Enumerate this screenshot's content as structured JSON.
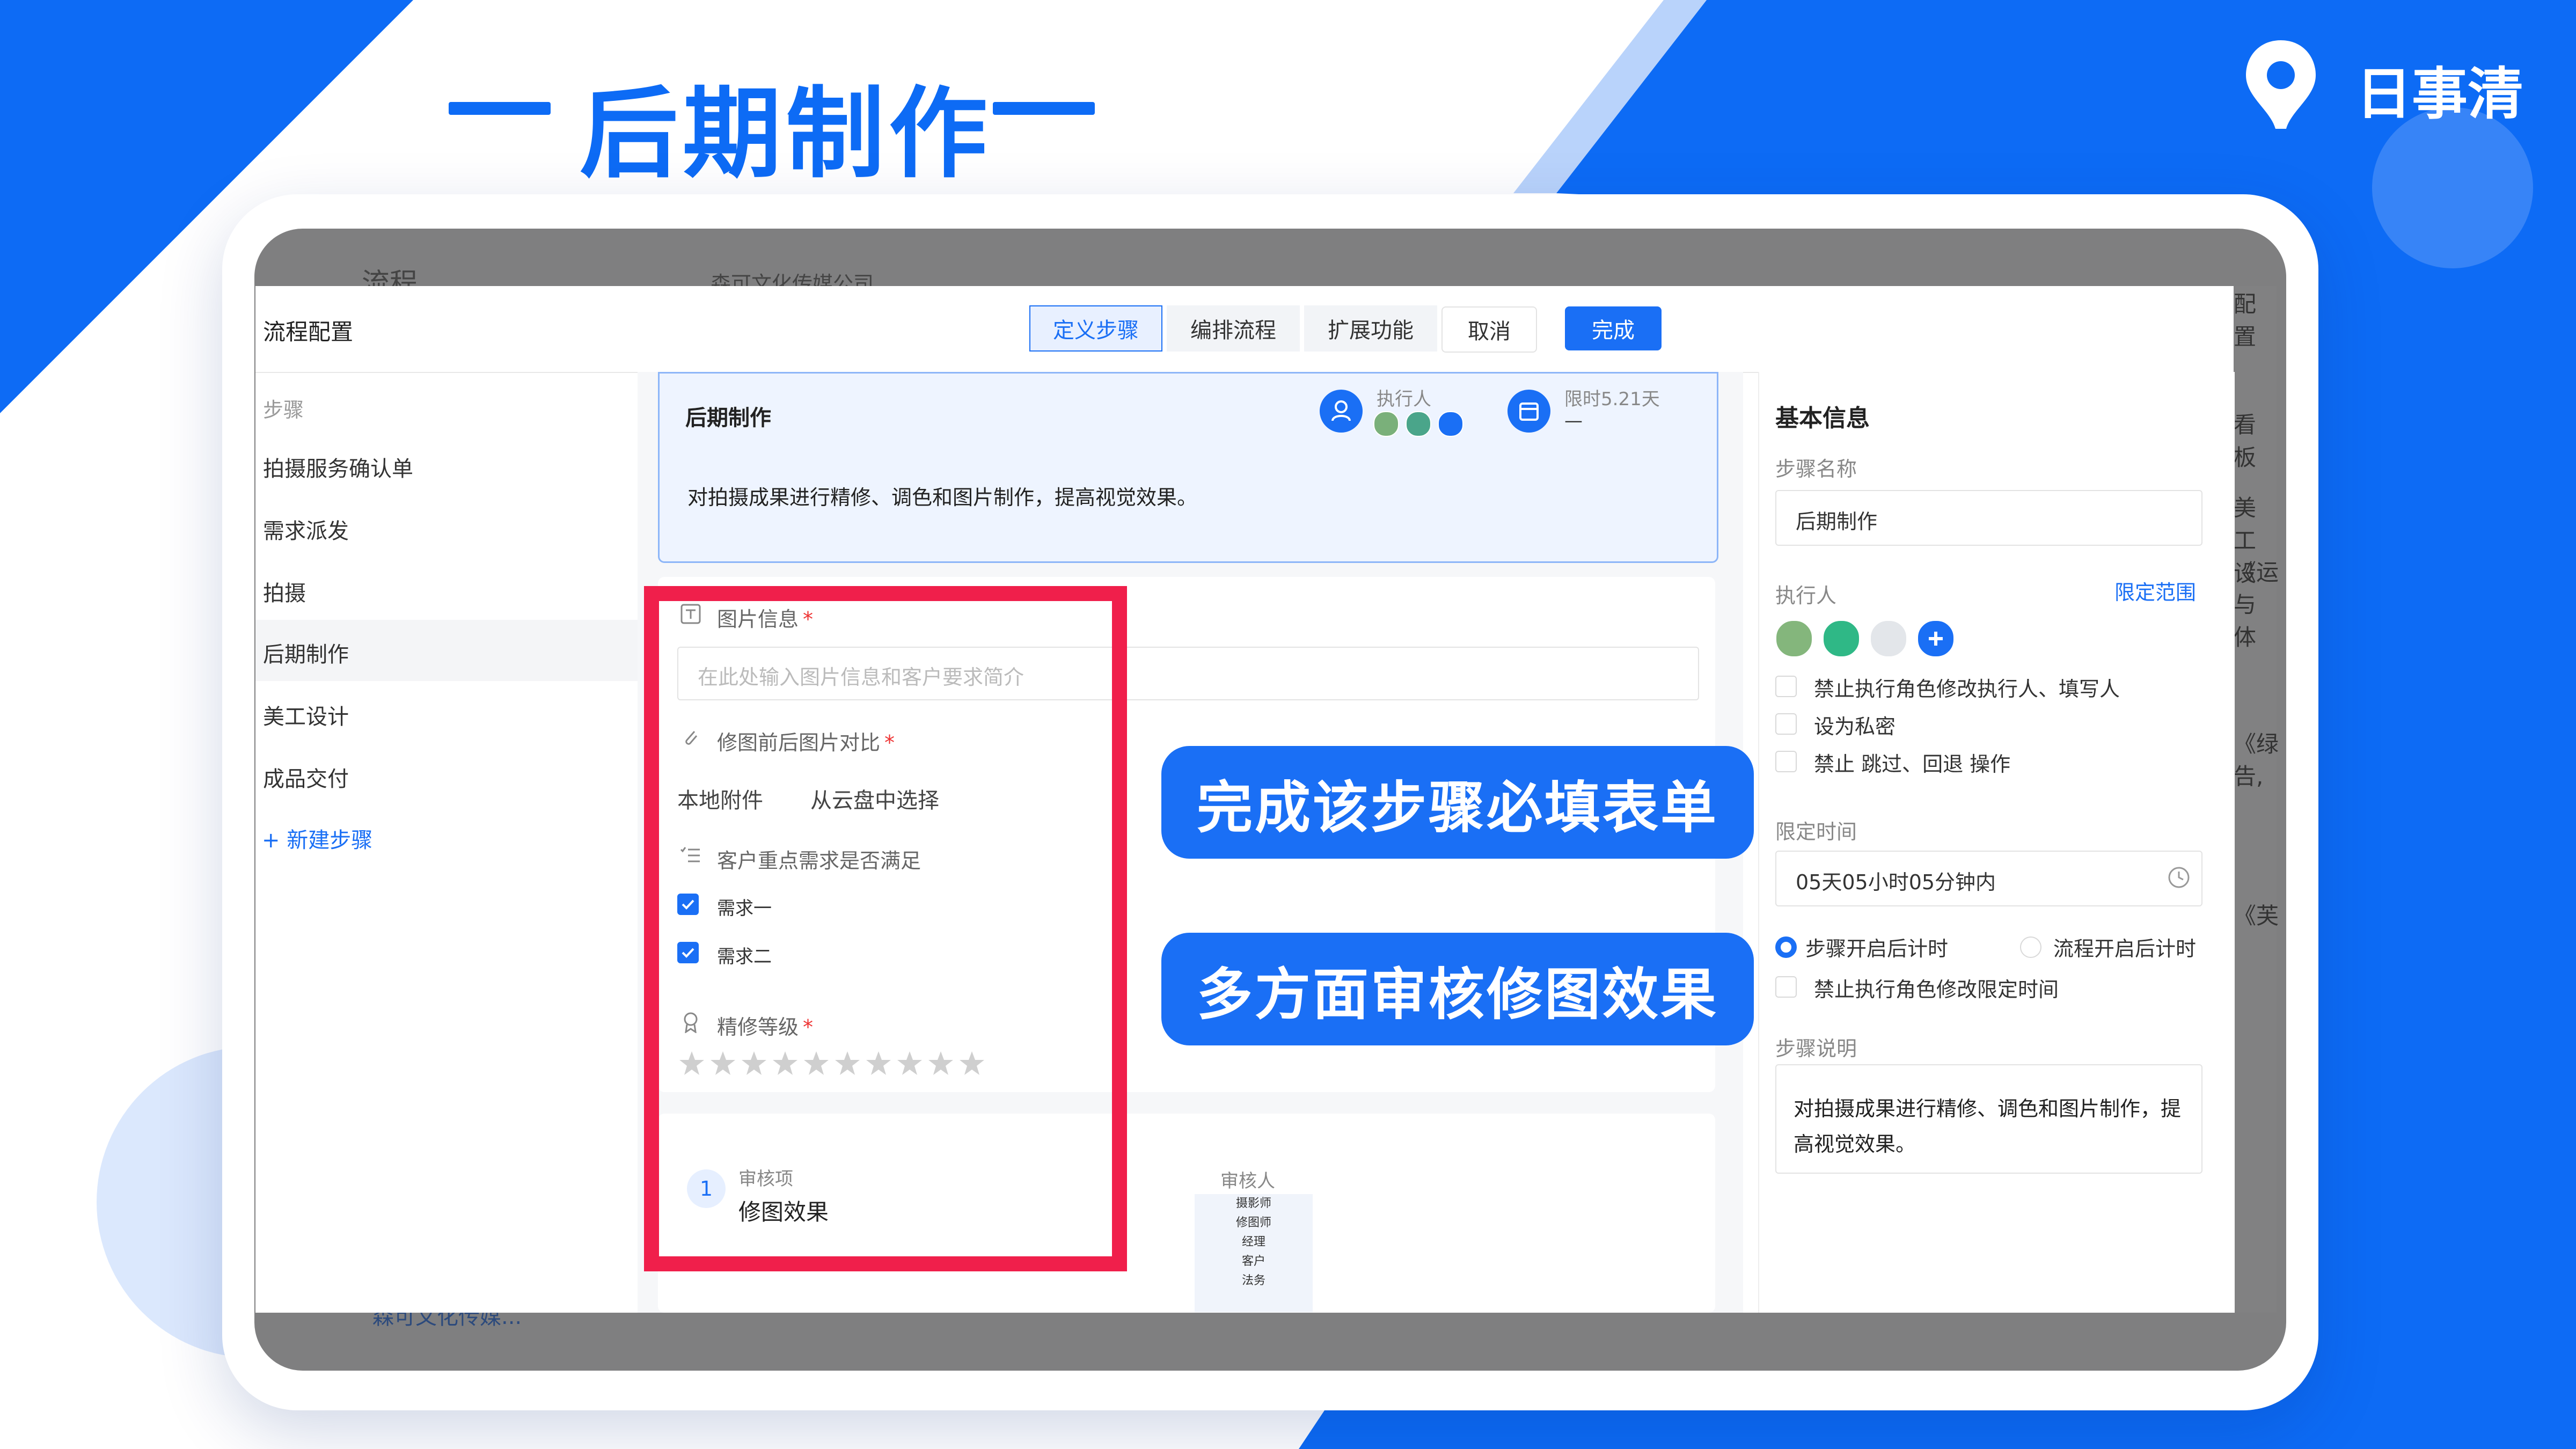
{
  "banner": {
    "title": "后期制作",
    "brand": "日事清"
  },
  "background_app": {
    "title_partial": "流程",
    "company_partial": "森可文化传媒公司",
    "footer_company": "森可文化传媒..."
  },
  "modal": {
    "title": "流程配置",
    "tabs": [
      "定义步骤",
      "编排流程",
      "扩展功能"
    ],
    "active_tab": "定义步骤",
    "cancel_label": "取消",
    "done_label": "完成"
  },
  "sidebar": {
    "section_label": "步骤",
    "steps": [
      "拍摄服务确认单",
      "需求派发",
      "拍摄",
      "后期制作",
      "美工设计",
      "成品交付"
    ],
    "active_step": "后期制作",
    "new_step_label": "+ 新建步骤"
  },
  "step_card": {
    "name": "后期制作",
    "executor_label": "执行人",
    "time_limit_label": "限时5.21天",
    "time_limit_value": "—",
    "description": "对拍摄成果进行精修、调色和图片制作，提高视觉效果。"
  },
  "form": {
    "image_info_label": "图片信息",
    "image_info_placeholder": "在此处输入图片信息和客户要求简介",
    "compare_label": "修图前后图片对比",
    "local_attachment": "本地附件",
    "cloud_select": "从云盘中选择",
    "requirement_label": "客户重点需求是否满足",
    "requirements": [
      "需求一",
      "需求二"
    ],
    "quality_label": "精修等级",
    "star_count": 10
  },
  "review": {
    "item_label": "审核项",
    "item_number": "1",
    "item_value": "修图效果",
    "reviewer_label": "审核人",
    "reviewers": [
      "摄影师",
      "修图师",
      "经理",
      "客户",
      "法务"
    ]
  },
  "right_panel": {
    "heading": "基本信息",
    "step_name_label": "步骤名称",
    "step_name_value": "后期制作",
    "executor_label": "执行人",
    "limit_range_link": "限定范围",
    "checkbox_1": "禁止执行角色修改执行人、填写人",
    "checkbox_2": "设为私密",
    "checkbox_3": "禁止 跳过、回退 操作",
    "time_limit_label": "限定时间",
    "time_limit_value": "05天05小时05分钟内",
    "radio_1": "步骤开启后计时",
    "radio_2": "流程开启后计时",
    "checkbox_4": "禁止执行角色修改限定时间",
    "description_label": "步骤说明",
    "description_value": "对拍摄成果进行精修、调色和图片制作，提高视觉效果。"
  },
  "right_strip": [
    "配置",
    "看板",
    "美工设",
    "《运",
    "与体",
    "《绿",
    "告,",
    "《芙"
  ],
  "callouts": [
    "完成该步骤必填表单",
    "多方面审核修图效果"
  ],
  "colors": {
    "brand_blue": "#0d6bf5",
    "highlight_red": "#f01f4b",
    "primary_button": "#1a6ff5"
  }
}
